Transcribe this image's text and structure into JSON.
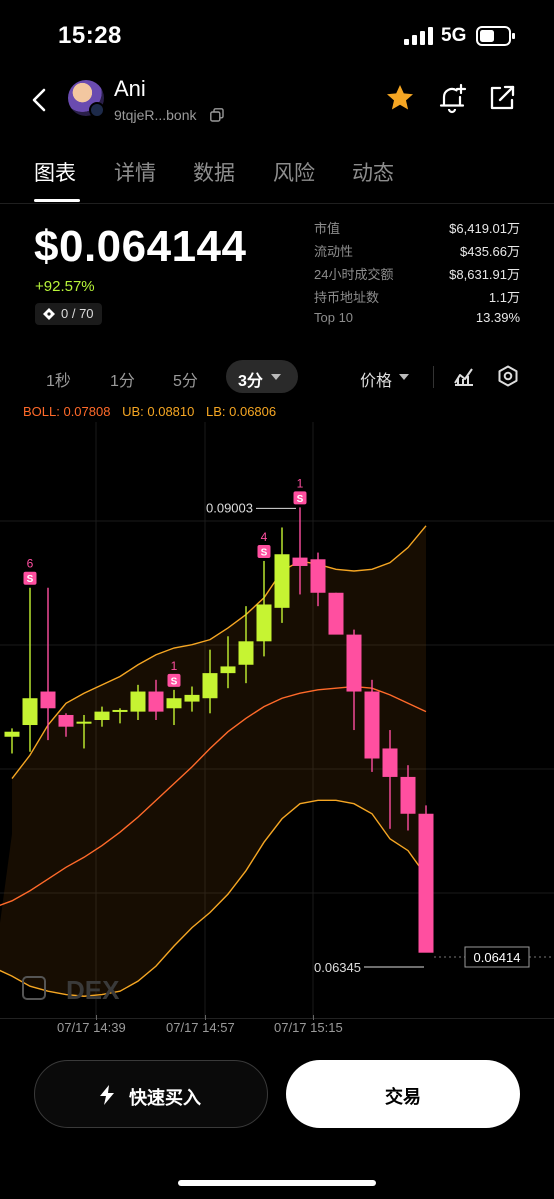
{
  "status_bar": {
    "time": "15:28",
    "network": "5G"
  },
  "header": {
    "token_name": "Ani",
    "token_address": "9tqjeR...bonk"
  },
  "tabs": [
    {
      "label": "图表",
      "active": true
    },
    {
      "label": "详情",
      "active": false
    },
    {
      "label": "数据",
      "active": false
    },
    {
      "label": "风险",
      "active": false
    },
    {
      "label": "动态",
      "active": false
    }
  ],
  "price_block": {
    "price": "$0.064144",
    "change": "+92.57%",
    "holders_badge": "0 / 70"
  },
  "stats": [
    {
      "label": "市值",
      "value": "$6,419.01万"
    },
    {
      "label": "流动性",
      "value": "$435.66万"
    },
    {
      "label": "24小时成交额",
      "value": "$8,631.91万"
    },
    {
      "label": "持币地址数",
      "value": "1.1万"
    },
    {
      "label": "Top 10",
      "value": "13.39%"
    }
  ],
  "intervals": {
    "options": [
      "1秒",
      "1分",
      "5分"
    ],
    "selected": "3分",
    "price_mode": "价格"
  },
  "boll_legend": {
    "boll": "BOLL: 0.07808",
    "ub": "UB: 0.08810",
    "lb": "LB: 0.06806"
  },
  "colors": {
    "up": "#c6f432",
    "down": "#ff4fa0",
    "ub_line": "#f5a623",
    "mid_line": "#ff6a2a",
    "accent_green": "#b8f53a",
    "star": "#f5a623"
  },
  "chart_data": {
    "type": "candlestick",
    "ylim": [
      0.0595,
      0.0951
    ],
    "last_price_label": "0.06414",
    "high_marker": "0.09003",
    "low_marker": "0.06345",
    "x_labels": [
      "07/17 14:39",
      "07/17 14:57",
      "07/17 15:15"
    ],
    "watermark": "DEX",
    "candles": [
      {
        "o": 0.0763,
        "h": 0.0768,
        "l": 0.0753,
        "c": 0.0766
      },
      {
        "o": 0.077,
        "h": 0.0852,
        "l": 0.0754,
        "c": 0.0786
      },
      {
        "o": 0.079,
        "h": 0.0852,
        "l": 0.0761,
        "c": 0.078
      },
      {
        "o": 0.0776,
        "h": 0.0777,
        "l": 0.0763,
        "c": 0.0769
      },
      {
        "o": 0.0771,
        "h": 0.0776,
        "l": 0.0756,
        "c": 0.0772
      },
      {
        "o": 0.0773,
        "h": 0.0781,
        "l": 0.0769,
        "c": 0.0778
      },
      {
        "o": 0.0778,
        "h": 0.078,
        "l": 0.0771,
        "c": 0.0779
      },
      {
        "o": 0.0778,
        "h": 0.0794,
        "l": 0.0773,
        "c": 0.079
      },
      {
        "o": 0.079,
        "h": 0.0797,
        "l": 0.0773,
        "c": 0.0778
      },
      {
        "o": 0.078,
        "h": 0.0791,
        "l": 0.077,
        "c": 0.0786
      },
      {
        "o": 0.0784,
        "h": 0.0793,
        "l": 0.0778,
        "c": 0.0788
      },
      {
        "o": 0.0786,
        "h": 0.0815,
        "l": 0.0777,
        "c": 0.0801
      },
      {
        "o": 0.0801,
        "h": 0.0823,
        "l": 0.0792,
        "c": 0.0805
      },
      {
        "o": 0.0806,
        "h": 0.0841,
        "l": 0.0795,
        "c": 0.082
      },
      {
        "o": 0.082,
        "h": 0.0868,
        "l": 0.0811,
        "c": 0.0842
      },
      {
        "o": 0.084,
        "h": 0.0888,
        "l": 0.0831,
        "c": 0.0872
      },
      {
        "o": 0.087,
        "h": 0.09,
        "l": 0.0848,
        "c": 0.0865
      },
      {
        "o": 0.0869,
        "h": 0.0873,
        "l": 0.0841,
        "c": 0.0849
      },
      {
        "o": 0.0849,
        "h": 0.0849,
        "l": 0.0832,
        "c": 0.0824
      },
      {
        "o": 0.0824,
        "h": 0.0827,
        "l": 0.0767,
        "c": 0.079
      },
      {
        "o": 0.079,
        "h": 0.0797,
        "l": 0.0742,
        "c": 0.075
      },
      {
        "o": 0.0756,
        "h": 0.0767,
        "l": 0.0708,
        "c": 0.0739
      },
      {
        "o": 0.0739,
        "h": 0.0746,
        "l": 0.0707,
        "c": 0.0717
      },
      {
        "o": 0.0717,
        "h": 0.0722,
        "l": 0.0692,
        "c": 0.0634
      }
    ],
    "signals": [
      {
        "index": 1,
        "count": "6",
        "label": "S"
      },
      {
        "index": 9,
        "count": "1",
        "label": "S"
      },
      {
        "index": 14,
        "count": "4",
        "label": "S"
      },
      {
        "index": 16,
        "count": "1",
        "label": "S"
      }
    ],
    "upper_band": [
      [
        0,
        0.0738
      ],
      [
        1,
        0.0752
      ],
      [
        2,
        0.077
      ],
      [
        3,
        0.0783
      ],
      [
        4,
        0.0789
      ],
      [
        5,
        0.0794
      ],
      [
        6,
        0.0799
      ],
      [
        7,
        0.0806
      ],
      [
        8,
        0.0812
      ],
      [
        9,
        0.0816
      ],
      [
        10,
        0.0818
      ],
      [
        11,
        0.0821
      ],
      [
        12,
        0.0828
      ],
      [
        13,
        0.0836
      ],
      [
        14,
        0.0846
      ],
      [
        15,
        0.0862
      ],
      [
        16,
        0.0868
      ],
      [
        17,
        0.0866
      ],
      [
        18,
        0.0863
      ],
      [
        19,
        0.0862
      ],
      [
        20,
        0.0863
      ],
      [
        21,
        0.0867
      ],
      [
        22,
        0.0876
      ],
      [
        23,
        0.0889
      ]
    ],
    "middle_band": [
      [
        -1,
        0.0661
      ],
      [
        0,
        0.0665
      ],
      [
        1,
        0.0671
      ],
      [
        2,
        0.0678
      ],
      [
        3,
        0.0685
      ],
      [
        4,
        0.0691
      ],
      [
        5,
        0.0698
      ],
      [
        6,
        0.0706
      ],
      [
        7,
        0.0715
      ],
      [
        8,
        0.0725
      ],
      [
        9,
        0.0735
      ],
      [
        10,
        0.0745
      ],
      [
        11,
        0.0756
      ],
      [
        12,
        0.0766
      ],
      [
        13,
        0.0774
      ],
      [
        14,
        0.0781
      ],
      [
        15,
        0.0786
      ],
      [
        16,
        0.0789
      ],
      [
        17,
        0.0791
      ],
      [
        18,
        0.0792
      ],
      [
        19,
        0.0793
      ],
      [
        20,
        0.0792
      ],
      [
        21,
        0.0788
      ],
      [
        22,
        0.0783
      ],
      [
        23,
        0.0778
      ]
    ],
    "lower_band": [
      [
        -1,
        0.0625
      ],
      [
        0,
        0.062
      ],
      [
        1,
        0.0614
      ],
      [
        2,
        0.0611
      ],
      [
        3,
        0.0609
      ],
      [
        4,
        0.0608
      ],
      [
        5,
        0.0609
      ],
      [
        6,
        0.0611
      ],
      [
        7,
        0.0617
      ],
      [
        8,
        0.0626
      ],
      [
        9,
        0.0638
      ],
      [
        10,
        0.0649
      ],
      [
        11,
        0.0658
      ],
      [
        12,
        0.0669
      ],
      [
        13,
        0.0683
      ],
      [
        14,
        0.07
      ],
      [
        15,
        0.0714
      ],
      [
        16,
        0.0723
      ],
      [
        17,
        0.0725
      ],
      [
        18,
        0.0725
      ],
      [
        19,
        0.0723
      ],
      [
        20,
        0.0717
      ],
      [
        21,
        0.0702
      ],
      [
        22,
        0.0695
      ],
      [
        23,
        0.068
      ]
    ]
  },
  "buttons": {
    "quick_buy": "快速买入",
    "trade": "交易"
  }
}
